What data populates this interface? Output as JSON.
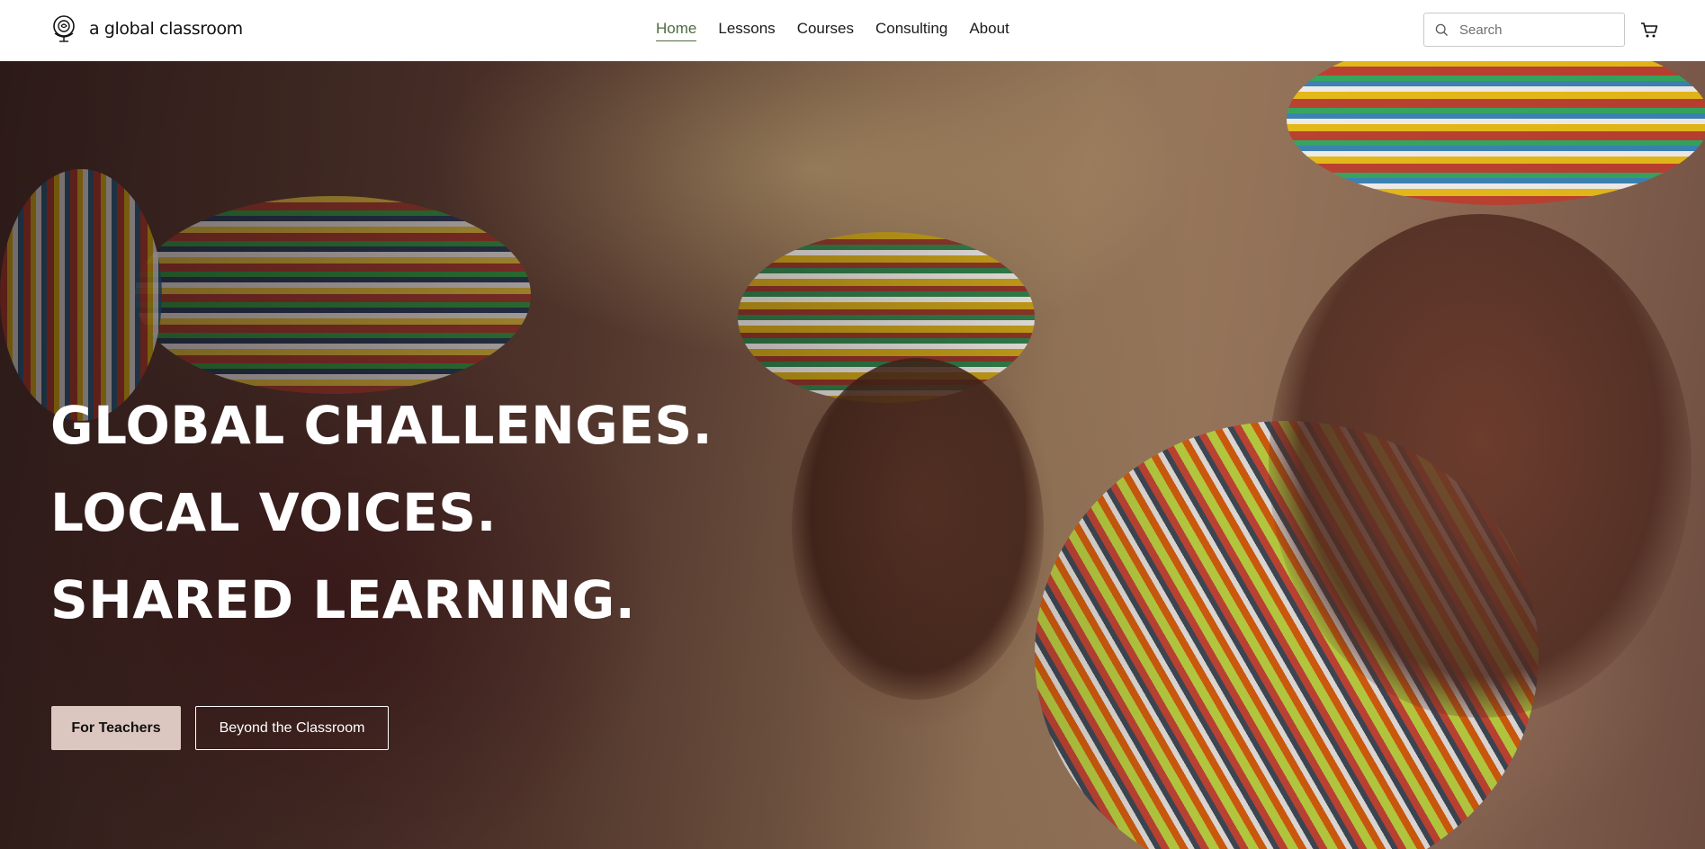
{
  "brand": {
    "name": "a global classroom"
  },
  "nav": {
    "items": [
      {
        "label": "Home",
        "active": true
      },
      {
        "label": "Lessons",
        "active": false
      },
      {
        "label": "Courses",
        "active": false
      },
      {
        "label": "Consulting",
        "active": false
      },
      {
        "label": "About",
        "active": false
      }
    ]
  },
  "search": {
    "placeholder": "Search",
    "icon": "search-icon"
  },
  "cart": {
    "icon": "cart-icon"
  },
  "hero": {
    "image_subject": "hero-photo",
    "headline": [
      "GLOBAL CHALLENGES.",
      "LOCAL VOICES.",
      "SHARED LEARNING."
    ],
    "primary_button": "For Teachers",
    "secondary_button": "Beyond the Classroom"
  },
  "colors": {
    "nav_active": "#4f6b3f",
    "primary_button_bg": "#dcc7c0",
    "text_dark": "#111111",
    "hero_text": "#ffffff"
  }
}
